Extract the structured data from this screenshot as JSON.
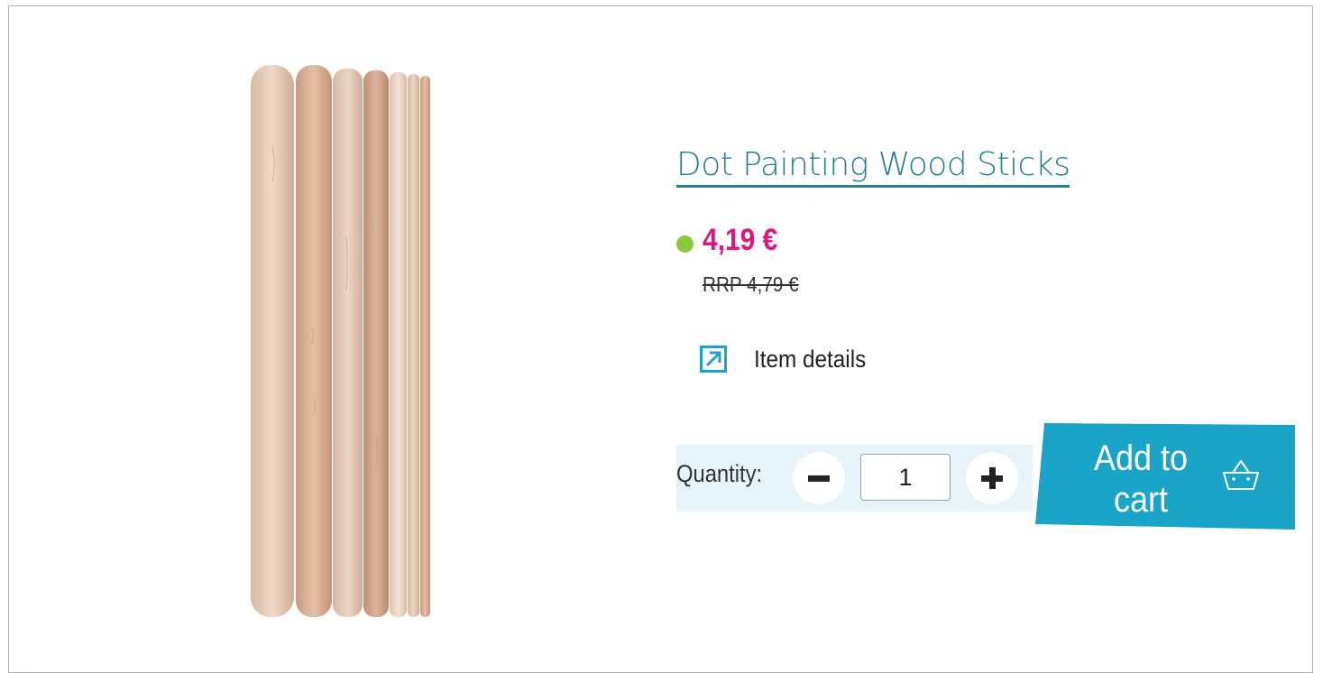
{
  "product": {
    "title": "Dot Painting Wood Sticks",
    "image_alt": "Wooden sticks of varying thickness",
    "stock_status_color": "#8dc63f",
    "price": "4,19 €",
    "rrp": "RRP 4,79 €",
    "price_color": "#e5147d"
  },
  "details": {
    "label": "Item details",
    "icon": "external-arrow-icon"
  },
  "quantity": {
    "label": "Quantity:",
    "value": "1",
    "decrement_icon": "minus-icon",
    "increment_icon": "plus-icon"
  },
  "cart": {
    "label": "Add to cart",
    "icon": "basket-icon",
    "color": "#1aa5c8"
  },
  "colors": {
    "title": "#2a7f95",
    "qty_background": "#e6f4f9",
    "accent": "#1aa5c8"
  }
}
